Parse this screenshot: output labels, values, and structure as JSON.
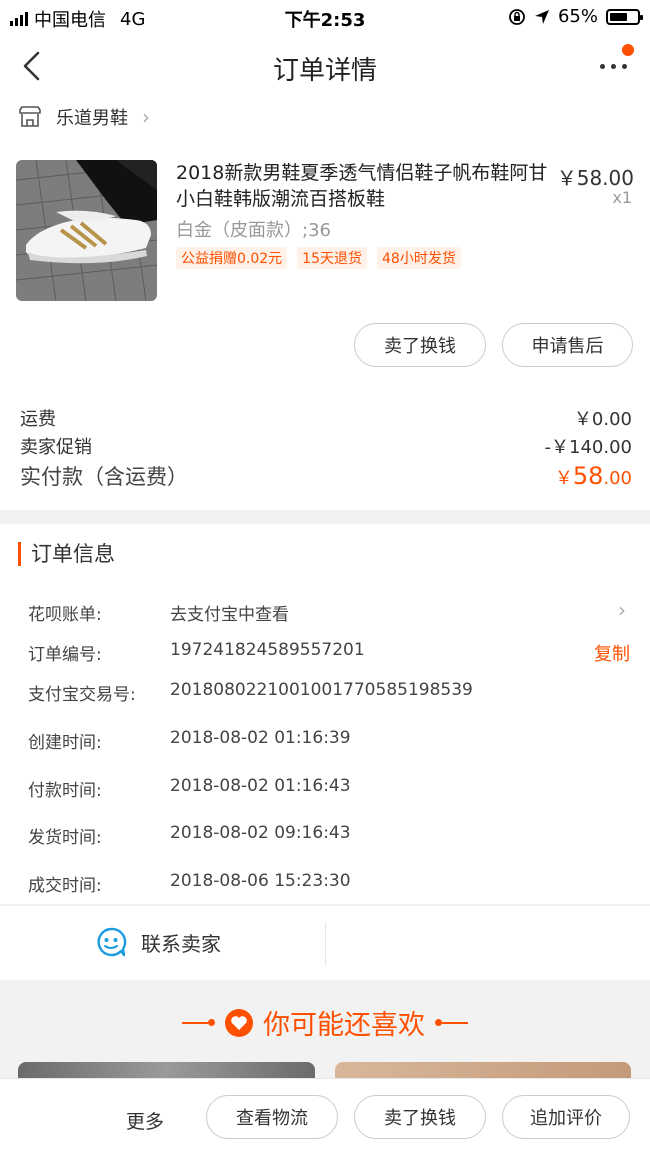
{
  "status_bar": {
    "carrier": "中国电信",
    "network": "4G",
    "time": "下午2:53",
    "battery": "65%",
    "battery_level": 0.65
  },
  "nav": {
    "title": "订单详情",
    "back_icon": "chevron-left-icon",
    "more_icon": "more-dots-icon"
  },
  "shop": {
    "name": "乐道男鞋",
    "icon": "store-icon"
  },
  "item": {
    "title": "2018新款男鞋夏季透气情侣鞋子帆布鞋阿甘小白鞋韩版潮流百搭板鞋",
    "price": "￥58.00",
    "quantity": "x1",
    "sku": "白金（皮面款）;36",
    "tags": [
      "公益捐赠0.02元",
      "15天退货",
      "48小时发货"
    ]
  },
  "item_actions": {
    "sell": "卖了换钱",
    "after_sale": "申请售后"
  },
  "fees": {
    "shipping_label": "运费",
    "shipping_value": "￥0.00",
    "promo_label": "卖家促销",
    "promo_value": "-￥140.00",
    "total_label": "实付款（含运费）",
    "total_currency": "￥",
    "total_int": "58",
    "total_dec": ".00"
  },
  "order_info": {
    "title": "订单信息",
    "rows": [
      {
        "label": "花呗账单:",
        "value": "去支付宝中查看"
      },
      {
        "label": "订单编号:",
        "value": "197241824589557201",
        "action": "复制"
      },
      {
        "label": "支付宝交易号:",
        "value": "2018080221001001770585198539"
      },
      {
        "label": "创建时间:",
        "value": "2018-08-02 01:16:39"
      },
      {
        "label": "付款时间:",
        "value": "2018-08-02 01:16:43"
      },
      {
        "label": "发货时间:",
        "value": "2018-08-02 09:16:43"
      },
      {
        "label": "成交时间:",
        "value": "2018-08-06 15:23:30"
      }
    ]
  },
  "contact": {
    "label": "联系卖家",
    "icon": "chat-bubble-icon"
  },
  "recommend": {
    "title": "你可能还喜欢"
  },
  "bottom_bar": {
    "more": "更多",
    "logistics": "查看物流",
    "sell": "卖了换钱",
    "review": "追加评价"
  },
  "colors": {
    "accent": "#ff5000",
    "text": "#333333",
    "muted": "#999999"
  }
}
